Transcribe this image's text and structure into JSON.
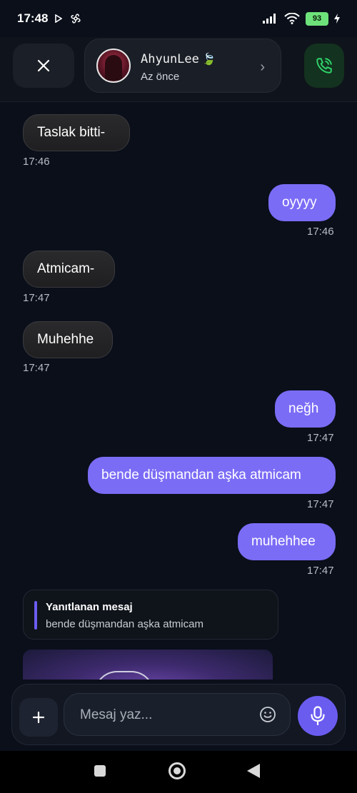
{
  "status_bar": {
    "time": "17:48",
    "battery": "93"
  },
  "header": {
    "contact_name": "AhyunLee",
    "contact_emoji": "🍃",
    "contact_status": "Az önce"
  },
  "messages": [
    {
      "direction": "in",
      "text": "Taslak bitti-",
      "time": "17:46"
    },
    {
      "direction": "out",
      "text": "oyyyy",
      "time": "17:46"
    },
    {
      "direction": "in",
      "text": "Atmicam-",
      "time": "17:47"
    },
    {
      "direction": "in",
      "text": "Muhehhe",
      "time": "17:47"
    },
    {
      "direction": "out",
      "text": "neğh",
      "time": "17:47"
    },
    {
      "direction": "out",
      "text": "bende düşmandan aşka atmicam",
      "time": "17:47"
    },
    {
      "direction": "out",
      "text": "muhehhee",
      "time": "17:47"
    }
  ],
  "reply_preview": {
    "title": "Yanıtlanan mesaj",
    "text": "bende düşmandan aşka atmicam"
  },
  "composer": {
    "placeholder": "Mesaj yaz..."
  },
  "icons": {
    "close": "close-icon",
    "call": "phone-icon",
    "plus": "plus-icon",
    "emoji": "smiley-icon",
    "mic": "microphone-icon"
  },
  "colors": {
    "accent": "#7b6cf6",
    "call_green": "#2fd36b"
  }
}
